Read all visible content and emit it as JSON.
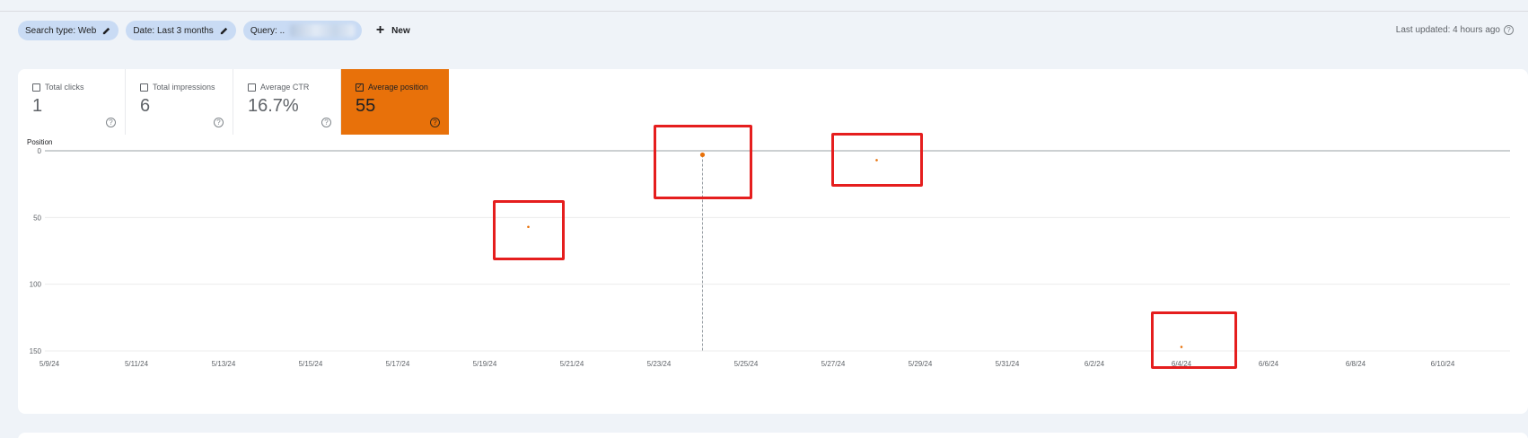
{
  "filters": {
    "search_type": "Search type: Web",
    "date": "Date: Last 3 months",
    "query": "Query: ..",
    "new_label": "New"
  },
  "last_updated": "Last updated: 4 hours ago",
  "metrics": [
    {
      "label": "Total clicks",
      "value": "1",
      "checked": false
    },
    {
      "label": "Total impressions",
      "value": "6",
      "checked": false
    },
    {
      "label": "Average CTR",
      "value": "16.7%",
      "checked": false
    },
    {
      "label": "Average position",
      "value": "55",
      "checked": true
    }
  ],
  "colors": {
    "accent": "#e8710a",
    "chip": "#c9dbf4",
    "annotation": "#e51e1e",
    "background": "#eff3f8"
  },
  "icons": [
    "pencil-icon",
    "plus-icon",
    "help-icon",
    "checkbox-icon"
  ],
  "chart_data": {
    "type": "scatter",
    "ylabel": "Position",
    "y_reversed": true,
    "ylim": [
      0,
      150
    ],
    "yticks": [
      0,
      50,
      100,
      150
    ],
    "xticks": [
      "5/9/24",
      "5/11/24",
      "5/13/24",
      "5/15/24",
      "5/17/24",
      "5/19/24",
      "5/21/24",
      "5/23/24",
      "5/25/24",
      "5/27/24",
      "5/29/24",
      "5/31/24",
      "6/2/24",
      "6/4/24",
      "6/6/24",
      "6/8/24",
      "6/10/24"
    ],
    "grid": true,
    "series": [
      {
        "color": "#e8710a",
        "points": [
          {
            "x": "2024-05-20",
            "y": 57
          },
          {
            "x": "2024-05-24",
            "y": 3
          },
          {
            "x": "2024-05-28",
            "y": 7
          },
          {
            "x": "2024-06-04",
            "y": 147
          }
        ]
      }
    ],
    "hover_x": "2024-05-24",
    "annotations": "red rectangles highlighting each data point"
  }
}
